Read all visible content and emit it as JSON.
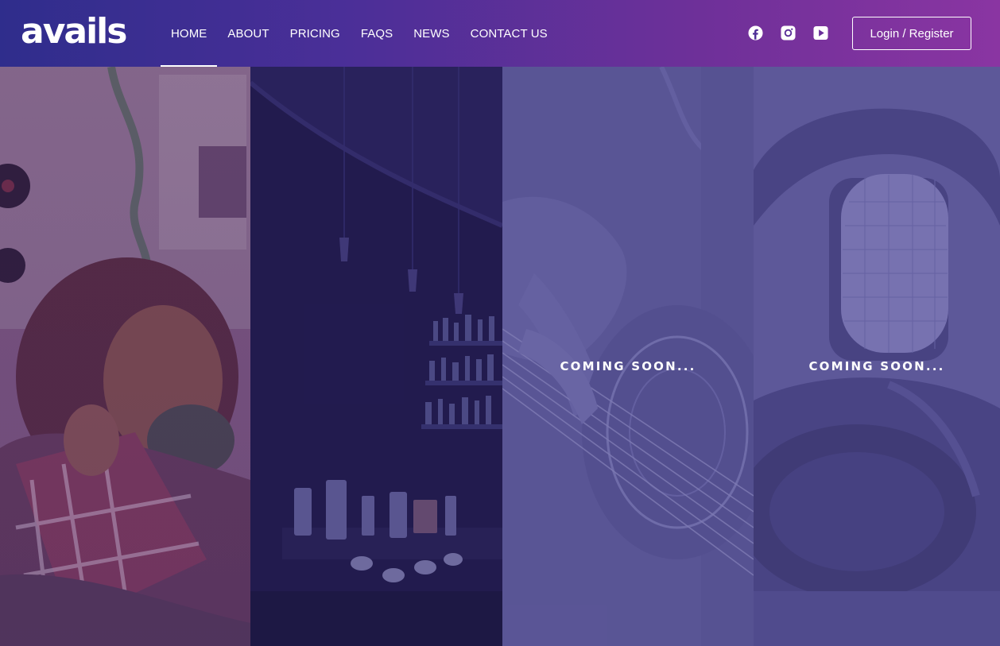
{
  "brand": {
    "logo_text": "avails"
  },
  "nav": {
    "items": [
      {
        "label": "HOME",
        "active": true
      },
      {
        "label": "ABOUT",
        "active": false
      },
      {
        "label": "PRICING",
        "active": false
      },
      {
        "label": "FAQS",
        "active": false
      },
      {
        "label": "NEWS",
        "active": false
      },
      {
        "label": "CONTACT US",
        "active": false
      }
    ]
  },
  "social": [
    {
      "icon": "facebook-icon"
    },
    {
      "icon": "instagram-icon"
    },
    {
      "icon": "youtube-icon"
    }
  ],
  "auth": {
    "login_label": "Login / Register"
  },
  "panels": [
    {
      "image": "woman-with-headphones-photo",
      "caption": ""
    },
    {
      "image": "bar-interior-photo",
      "caption": ""
    },
    {
      "image": "guitar-photo",
      "caption": "COMING SOON..."
    },
    {
      "image": "studio-microphone-photo",
      "caption": "COMING SOON..."
    }
  ],
  "colors": {
    "header_gradient_start": "#2f2d8c",
    "header_gradient_end": "#8a35a2",
    "panel_overlay_light": "#5a5596",
    "panel_overlay_dark": "#251e4f",
    "text": "#ffffff"
  }
}
